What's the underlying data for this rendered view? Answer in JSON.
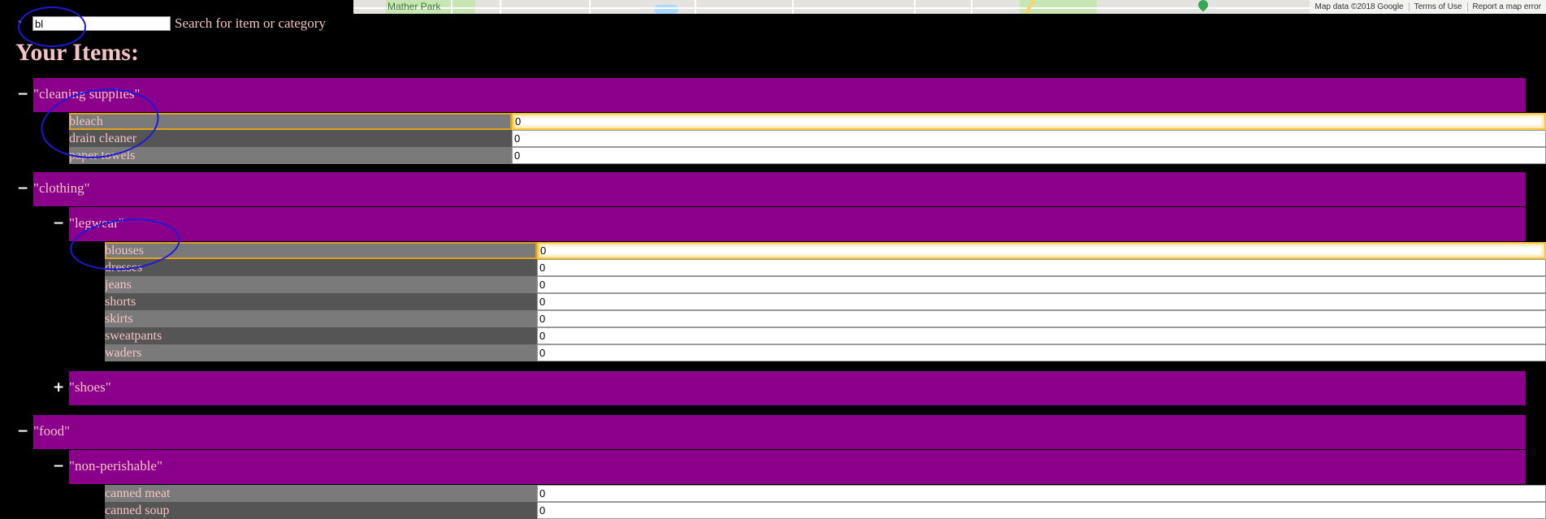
{
  "map": {
    "park_label": "Mather Park",
    "attribution": [
      "Map data ©2018 Google",
      "Terms of Use",
      "Report a map error"
    ]
  },
  "search": {
    "marker": "\"",
    "value": "bl",
    "label": "Search for item or category"
  },
  "page_title": "Your Items:",
  "toggles": {
    "expanded": "−",
    "collapsed": "+"
  },
  "categories": {
    "cleaning": {
      "label": "\"cleaning supplies\"",
      "items": [
        {
          "name": "bleach",
          "qty": "0"
        },
        {
          "name": "drain cleaner",
          "qty": "0"
        },
        {
          "name": "paper towels",
          "qty": "0"
        }
      ]
    },
    "clothing": {
      "label": "\"clothing\"",
      "legwear": {
        "label": "\"legwear\"",
        "items": [
          {
            "name": "blouses",
            "qty": "0"
          },
          {
            "name": "dresses",
            "qty": "0"
          },
          {
            "name": "jeans",
            "qty": "0"
          },
          {
            "name": "shorts",
            "qty": "0"
          },
          {
            "name": "skirts",
            "qty": "0"
          },
          {
            "name": "sweatpants",
            "qty": "0"
          },
          {
            "name": "waders",
            "qty": "0"
          }
        ]
      },
      "shoes": {
        "label": "\"shoes\""
      }
    },
    "food": {
      "label": "\"food\"",
      "non_perishable": {
        "label": "\"non-perishable\"",
        "items": [
          {
            "name": "canned meat",
            "qty": "0"
          },
          {
            "name": "canned soup",
            "qty": "0"
          }
        ]
      }
    }
  },
  "colors": {
    "background": "#000000",
    "category_bg": "#8b008b",
    "text": "#f4c4c4",
    "annotation": "#1a1ad8",
    "focus": "#f5c542"
  }
}
